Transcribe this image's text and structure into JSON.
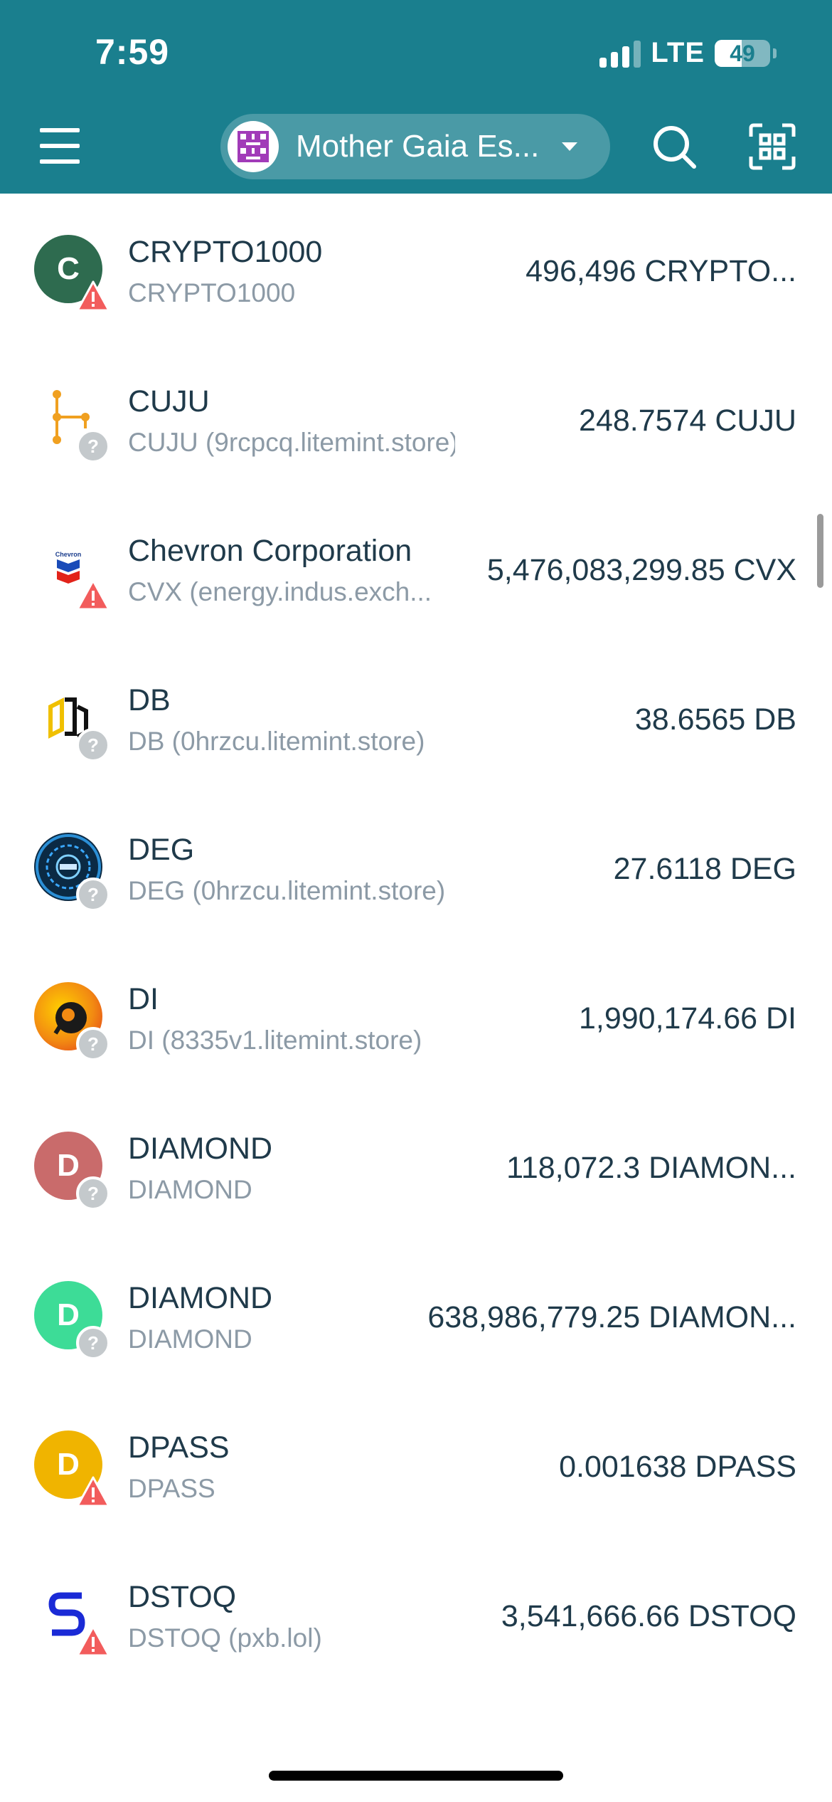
{
  "status_bar": {
    "time": "7:59",
    "network": "LTE",
    "battery_percent": "49",
    "battery_level": 0.49
  },
  "header": {
    "account_name": "Mother Gaia Es...",
    "colors": {
      "background": "#1a7f8e",
      "pill": "#4a9aa6"
    }
  },
  "assets": [
    {
      "name": "CRYPTO1000",
      "subtitle": "CRYPTO1000",
      "amount": "496,496 CRYPTO...",
      "logo_letter": "C",
      "logo_color": "#2e6b4f",
      "badge": "warning-icon"
    },
    {
      "name": "CUJU",
      "subtitle": "CUJU (9rcpcq.litemint.store)",
      "amount": "248.7574 CUJU",
      "logo_letter": "",
      "logo_color": "#ffffff",
      "badge": "question-icon"
    },
    {
      "name": "Chevron Corporation",
      "subtitle": "CVX (energy.indus.exch...",
      "amount": "5,476,083,299.85 CVX",
      "logo_letter": "",
      "logo_color": "#ffffff",
      "badge": "warning-icon"
    },
    {
      "name": "DB",
      "subtitle": "DB (0hrzcu.litemint.store)",
      "amount": "38.6565 DB",
      "logo_letter": "",
      "logo_color": "#ffffff",
      "badge": "question-icon"
    },
    {
      "name": "DEG",
      "subtitle": "DEG (0hrzcu.litemint.store)",
      "amount": "27.6118 DEG",
      "logo_letter": "",
      "logo_color": "#0b2a44",
      "badge": "question-icon"
    },
    {
      "name": "DI",
      "subtitle": "DI (8335v1.litemint.store)",
      "amount": "1,990,174.66 DI",
      "logo_letter": "",
      "logo_color": "#f28a12",
      "badge": "question-icon"
    },
    {
      "name": "DIAMOND",
      "subtitle": "DIAMOND",
      "amount": "118,072.3 DIAMON...",
      "logo_letter": "D",
      "logo_color": "#c96b6b",
      "badge": "question-icon"
    },
    {
      "name": "DIAMOND",
      "subtitle": "DIAMOND",
      "amount": "638,986,779.25 DIAMON...",
      "logo_letter": "D",
      "logo_color": "#3ddc97",
      "badge": "question-icon"
    },
    {
      "name": "DPASS",
      "subtitle": "DPASS",
      "amount": "0.001638 DPASS",
      "logo_letter": "D",
      "logo_color": "#f0b400",
      "badge": "warning-icon"
    },
    {
      "name": "DSTOQ",
      "subtitle": "DSTOQ (pxb.lol)",
      "amount": "3,541,666.66 DSTOQ",
      "logo_letter": "",
      "logo_color": "#ffffff",
      "badge": "warning-icon"
    }
  ],
  "colors": {
    "text_primary": "#1f3a4a",
    "text_secondary": "#8c9aa6",
    "warning": "#f25c5c",
    "question": "#c4c9cc"
  }
}
